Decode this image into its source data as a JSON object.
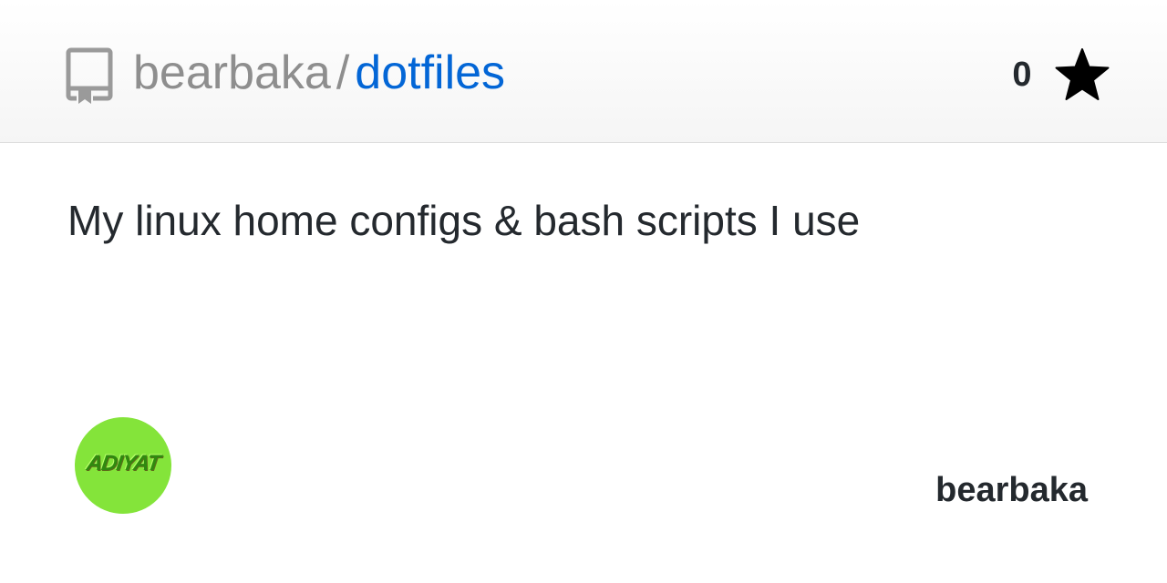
{
  "header": {
    "owner": "bearbaka",
    "separator": "/",
    "repo_name": "dotfiles",
    "star_count": "0",
    "repo_icon": "repo-icon",
    "star_icon": "star-icon"
  },
  "description": "My linux home configs & bash scripts I use",
  "footer": {
    "avatar_text": "ADIYAT",
    "author_name": "bearbaka"
  },
  "colors": {
    "owner": "#8e8e8e",
    "repo_link": "#0366d6",
    "text": "#24292e",
    "avatar_bg": "#84e43a"
  }
}
